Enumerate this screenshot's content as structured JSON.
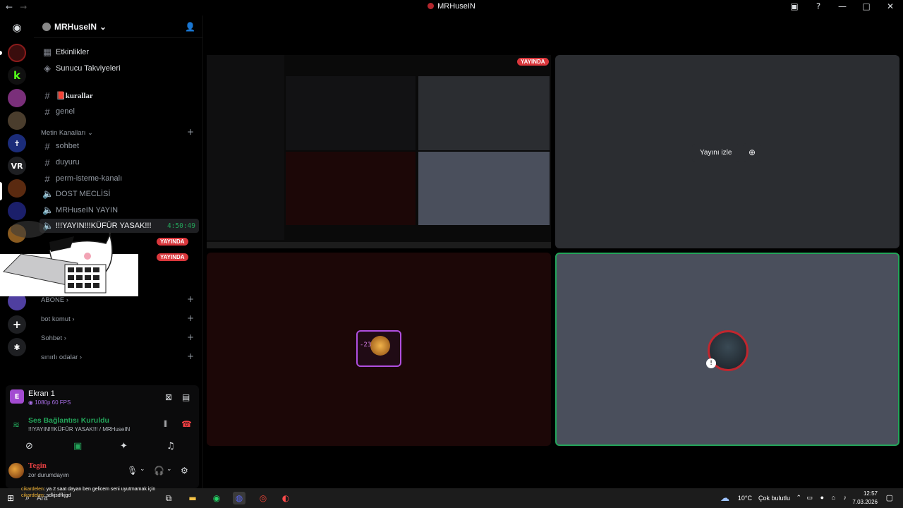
{
  "window": {
    "title": "MRHuseIN",
    "nav_back": "←",
    "nav_forward": "→"
  },
  "titlebar_icons": [
    "inbox-icon",
    "help-icon",
    "minimize-icon",
    "maximize-icon",
    "close-icon"
  ],
  "guild": {
    "name": "MRHuseIN"
  },
  "channels": {
    "top_items": [
      {
        "label": "Etkinlikler",
        "icon": "calendar-icon"
      },
      {
        "label": "Sunucu Takviyeleri",
        "icon": "boost-icon"
      }
    ],
    "text_items": [
      {
        "label": "📕kurallar"
      },
      {
        "label": "genel"
      }
    ],
    "category_text": "Metin Kanalları",
    "category_text_items": [
      {
        "label": "sohbet"
      },
      {
        "label": "duyuru"
      },
      {
        "label": "perm-isteme-kanalı"
      },
      {
        "label": "DOST MECLİSİ"
      },
      {
        "label": "MRHuseIN YAYIN"
      },
      {
        "label": "!!!YAYIN!!!KÜFÜR YASAK!!!"
      }
    ],
    "active_timer": "4:50:49",
    "live_label": "YAYINDA",
    "categories": [
      {
        "label": "ABONE"
      },
      {
        "label": "bot komut"
      },
      {
        "label": "Sohbet"
      },
      {
        "label": "sınırlı odalar"
      }
    ]
  },
  "stream": {
    "badge": "E",
    "title": "Ekran 1",
    "quality": "1080p 60 FPS"
  },
  "voice": {
    "status": "Ses Bağlantısı Kuruldu",
    "channel": "!!!YAYIN!!!KÜFÜR YASAK!!! / MRHuseIN"
  },
  "user": {
    "name": "Tegin",
    "status": "zor durumdayım"
  },
  "main": {
    "live_badge": "YAYINDA",
    "watch_label": "Yayını izle",
    "lion_caption": "-23"
  },
  "taskbar": {
    "search_placeholder": "Ara",
    "weather_temp": "10°C",
    "weather_text": "Çok bulutlu",
    "time": "12:57",
    "date": "7.03.2026",
    "notif1_user": "cikardelen",
    "notif1_text": ": ya 2 saat dayan ben gelicem seni uyutmamak için",
    "notif2_user": "cikardelen",
    "notif2_text": ": sdkjsdfkjgd"
  },
  "colors": {
    "accent_green": "#23a55a",
    "live_red": "#da373c",
    "tile_gray": "#2b2d31",
    "tile_dark_red": "#1c0707",
    "tile_slate": "#4a4f5c"
  }
}
